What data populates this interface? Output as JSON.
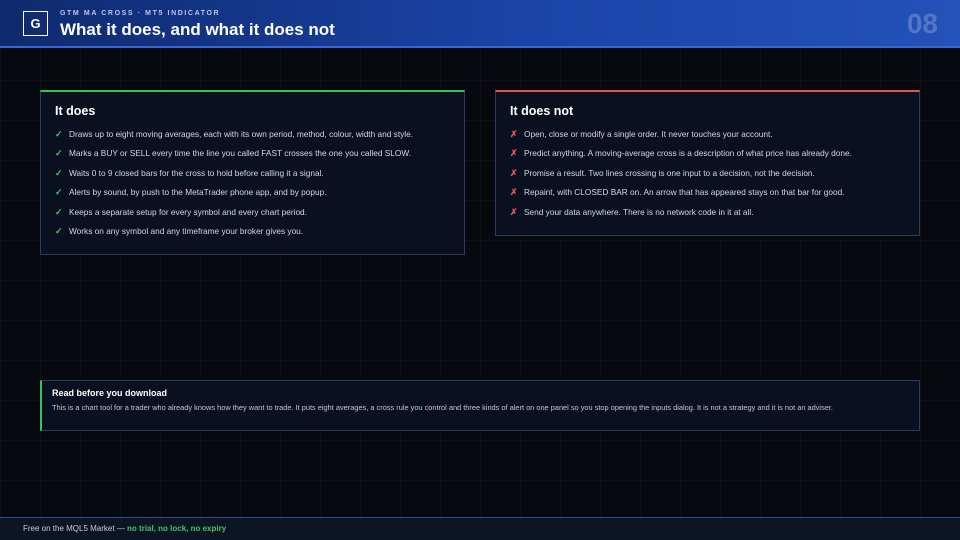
{
  "header": {
    "logo_letter": "G",
    "kicker": "GTM MA CROSS · MT5 INDICATOR",
    "title": "What it does, and what it does not",
    "slide_number": "08"
  },
  "does": {
    "title": "It does",
    "items": [
      "Draws up to eight moving averages, each with its own period, method, colour, width and style.",
      "Marks a BUY or SELL every time the line you called FAST crosses the one you called SLOW.",
      "Waits 0 to 9 closed bars for the cross to hold before calling it a signal.",
      "Alerts by sound, by push to the MetaTrader phone app, and by popup.",
      "Keeps a separate setup for every symbol and every chart period.",
      "Works on any symbol and any timeframe your broker gives you."
    ]
  },
  "does_not": {
    "title": "It does not",
    "items": [
      "Open, close or modify a single order. It never touches your account.",
      "Predict anything. A moving-average cross is a description of what price has already done.",
      "Promise a result. Two lines crossing is one input to a decision, not the decision.",
      "Repaint, with CLOSED BAR on. An arrow that has appeared stays on that bar for good.",
      "Send your data anywhere. There is no network code in it at all."
    ]
  },
  "marks": {
    "check": "✓",
    "cross": "✗"
  },
  "note": {
    "title": "Read before you download",
    "body": "This is a chart tool for a trader who already knows how they want to trade. It puts eight averages, a cross rule you control and three kinds of alert on one panel so you stop opening the inputs dialog. It is not a strategy and it is not an adviser."
  },
  "footer": {
    "text": "Free on the MQL5 Market — ",
    "accent": "no trial, no lock, no expiry"
  },
  "colors": {
    "header_start": "#0f2a6e",
    "header_end": "#2452b8",
    "positive": "#43c45c",
    "negative": "#e5584c",
    "background": "#07090f"
  }
}
